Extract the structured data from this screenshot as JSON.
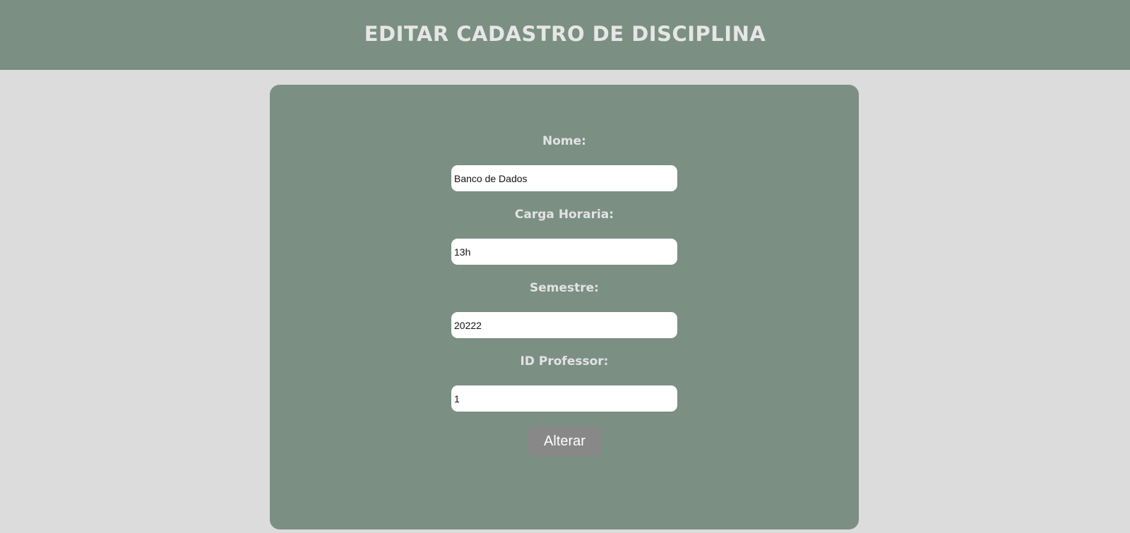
{
  "header": {
    "title": "EDITAR CADASTRO DE DISCIPLINA"
  },
  "form": {
    "nome": {
      "label": "Nome:",
      "value": "Banco de Dados"
    },
    "carga_horaria": {
      "label": "Carga Horaria:",
      "value": "13h"
    },
    "semestre": {
      "label": "Semestre:",
      "value": "20222"
    },
    "id_professor": {
      "label": "ID Professor:",
      "value": "1"
    },
    "submit_label": "Alterar"
  },
  "colors": {
    "header_bg": "#7b8f83",
    "page_bg": "#dcdcdc",
    "card_bg": "#7b8f83",
    "button_bg": "#888888",
    "label_text": "#e3e3e3"
  }
}
